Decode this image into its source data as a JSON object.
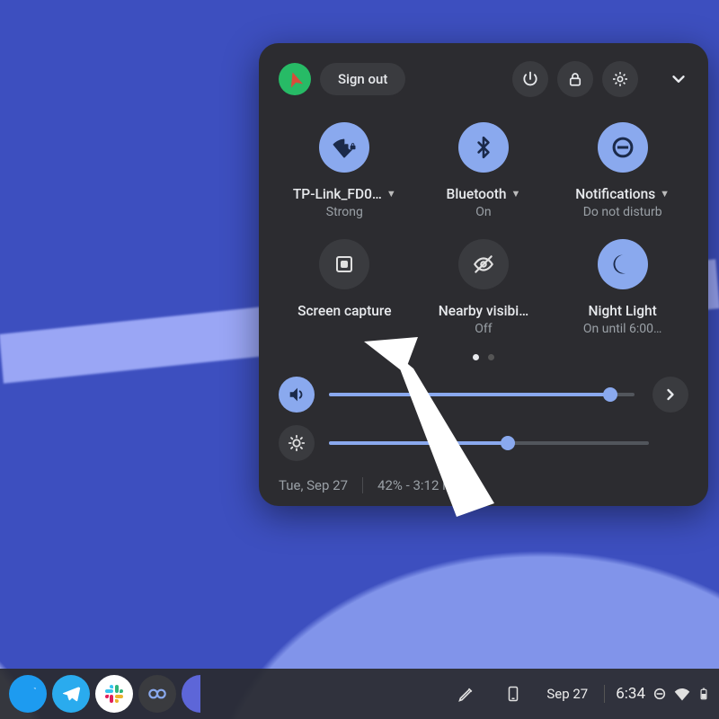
{
  "header": {
    "sign_out": "Sign out"
  },
  "tiles": {
    "wifi": {
      "label": "TP-Link_FD0…",
      "status": "Strong"
    },
    "bluetooth": {
      "label": "Bluetooth",
      "status": "On"
    },
    "notifications": {
      "label": "Notifications",
      "status": "Do not disturb"
    },
    "screen_capture": {
      "label": "Screen capture"
    },
    "nearby": {
      "label": "Nearby visibi…",
      "status": "Off"
    },
    "night_light": {
      "label": "Night Light",
      "status": "On until 6:00…"
    }
  },
  "sliders": {
    "volume_pct": 92,
    "brightness_pct": 56
  },
  "footer": {
    "date": "Tue, Sep 27",
    "battery": "42% - 3:12 left"
  },
  "shelf": {
    "date": "Sep 27",
    "time": "6:34"
  }
}
